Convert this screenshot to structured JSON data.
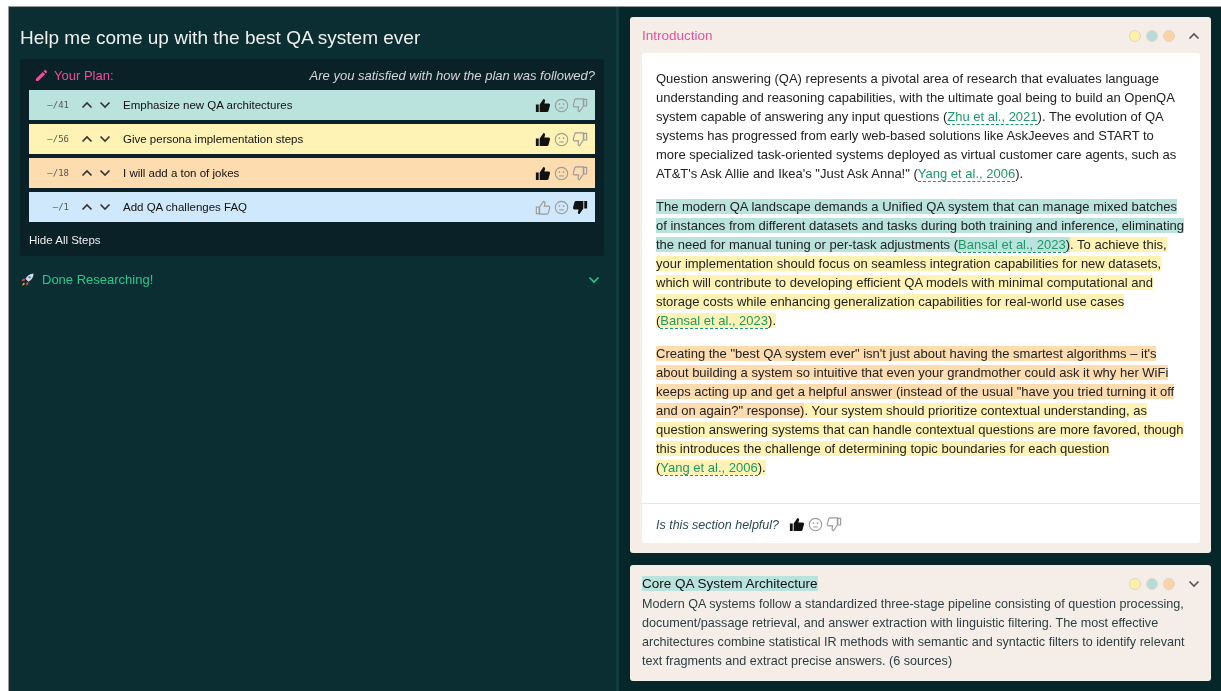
{
  "title": "Help me come up with the best QA system ever",
  "plan": {
    "heading": "Your Plan:",
    "question": "Are you satisfied with how the plan was followed?",
    "steps": [
      {
        "count": "–/41",
        "label": "Emphasize new QA architectures",
        "color": "#b9e3dc",
        "thumbs_up": true,
        "thumbs_down": false
      },
      {
        "count": "–/56",
        "label": "Give persona implementation steps",
        "color": "#fef3b4",
        "thumbs_up": true,
        "thumbs_down": false
      },
      {
        "count": "–/18",
        "label": "I will add a ton of jokes",
        "color": "#fddcb0",
        "thumbs_up": true,
        "thumbs_down": false
      },
      {
        "count": "–/1",
        "label": "Add QA challenges FAQ",
        "color": "#cfe8fb",
        "thumbs_up": false,
        "thumbs_down": true
      }
    ],
    "toggle": "Hide All Steps"
  },
  "done": {
    "label": "Done Researching!",
    "expanded": false
  },
  "sections": [
    {
      "title": "Introduction",
      "expanded": true,
      "dots": [
        {
          "color": "#fdf2a8"
        },
        {
          "color": "#b4ddd9"
        },
        {
          "color": "#fbd3a4"
        }
      ],
      "paragraphs": [
        {
          "runs": [
            {
              "segments": [
                {
                  "kind": "text",
                  "text": "Question answering (QA) represents a pivotal area of research that evaluates language understanding and reasoning capabilities, with the ultimate goal being to build an OpenQA system capable of answering any input questions ("
                },
                {
                  "kind": "cite",
                  "text": "Zhu et al., 2021"
                },
                {
                  "kind": "text",
                  "text": "). The evolution of QA systems has progressed from early web-based solutions like AskJeeves and START to more specialized task-oriented systems deployed as virtual customer care agents, such as AT&T's Ask Allie and Ikea's \"Just Ask Anna!\" ("
                },
                {
                  "kind": "cite",
                  "text": "Yang et al., 2006"
                },
                {
                  "kind": "text",
                  "text": ")."
                }
              ]
            }
          ]
        },
        {
          "runs": [
            {
              "color": "#b9e3dc",
              "segments": [
                {
                  "kind": "text",
                  "text": "The modern QA landscape demands a Unified QA system that can manage mixed batches of instances from different datasets and tasks during both training and inference, eliminating the need for manual tuning or per-task adjustments ("
                },
                {
                  "kind": "cite",
                  "text": "Bansal et al., 2023"
                },
                {
                  "kind": "text",
                  "text": ")"
                }
              ]
            },
            {
              "color": "#fef3b4",
              "segments": [
                {
                  "kind": "text",
                  "text": ". To achieve this, your implementation should focus on seamless integration capabilities for new datasets, which will contribute to developing efficient QA models with minimal computational and storage costs while enhancing generalization capabilities for real-world use cases ("
                },
                {
                  "kind": "cite",
                  "text": "Bansal et al., 2023"
                },
                {
                  "kind": "text",
                  "text": ")."
                }
              ]
            }
          ]
        },
        {
          "runs": [
            {
              "color": "#fddcb0",
              "segments": [
                {
                  "kind": "text",
                  "text": "Creating the \"best QA system ever\" isn't just about having the smartest algorithms – it's about building a system so intuitive that even your grandmother could ask it why her WiFi keeps acting up and get a helpful answer (instead of the usual \"have you tried turning it off and on again?\" response)"
                }
              ]
            },
            {
              "color": "#fef3b4",
              "segments": [
                {
                  "kind": "text",
                  "text": ". Your system should prioritize contextual understanding, as question answering systems that can handle contextual questions are more favored, though this introduces the challenge of determining topic boundaries for each question ("
                },
                {
                  "kind": "cite",
                  "text": "Yang et al., 2006"
                },
                {
                  "kind": "text",
                  "text": ")."
                }
              ]
            }
          ]
        }
      ],
      "feedback": {
        "question": "Is this section helpful?",
        "thumbs_up": true,
        "thumbs_down": false
      }
    },
    {
      "title": "Core QA System Architecture",
      "color": "#b9e3dc",
      "expanded": false,
      "dots": [
        {
          "color": "#fdf2a8"
        },
        {
          "color": "#b4ddd9"
        },
        {
          "color": "#fbd3a4"
        }
      ],
      "summary": "Modern QA systems follow a standardized three-stage pipeline consisting of question processing, document/passage retrieval, and answer extraction with linguistic filtering. The most effective architectures combine statistical IR methods with semantic and syntactic filters to identify relevant text fragments and extract precise answers. (6 sources)"
    }
  ]
}
